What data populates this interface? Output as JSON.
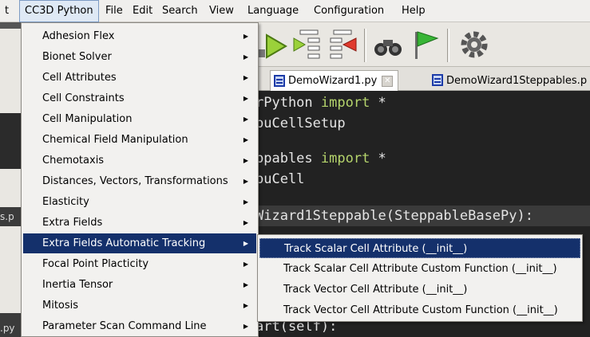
{
  "menubar": {
    "items": [
      {
        "label": "t"
      },
      {
        "label": "CC3D Python"
      },
      {
        "label": "File"
      },
      {
        "label": "Edit"
      },
      {
        "label": "Search"
      },
      {
        "label": "View"
      },
      {
        "label": "Language"
      },
      {
        "label": "Configuration"
      },
      {
        "label": "Help"
      }
    ]
  },
  "cc3d_menu": {
    "items": [
      {
        "label": "Adhesion Flex"
      },
      {
        "label": "Bionet Solver"
      },
      {
        "label": "Cell Attributes"
      },
      {
        "label": "Cell Constraints"
      },
      {
        "label": "Cell Manipulation"
      },
      {
        "label": "Chemical Field Manipulation"
      },
      {
        "label": "Chemotaxis"
      },
      {
        "label": "Distances, Vectors, Transformations"
      },
      {
        "label": "Elasticity"
      },
      {
        "label": "Extra Fields"
      },
      {
        "label": "Extra Fields Automatic Tracking"
      },
      {
        "label": "Focal Point Placticity"
      },
      {
        "label": "Inertia Tensor"
      },
      {
        "label": "Mitosis"
      },
      {
        "label": "Parameter Scan Command Line"
      }
    ],
    "arrow": "▶"
  },
  "tracking_submenu": {
    "items": [
      {
        "label": "Track Scalar Cell Attribute (__init__)"
      },
      {
        "label": "Track Scalar Cell Attribute Custom Function (__init__)"
      },
      {
        "label": "Track Vector Cell Attribute (__init__)"
      },
      {
        "label": "Track Vector Cell Attribute Custom Function (__init__)"
      }
    ]
  },
  "tabs": [
    {
      "label": "DemoWizard1.py",
      "close": "✕"
    },
    {
      "label": "DemoWizard1Steppables.p"
    }
  ],
  "editor": {
    "lines": [
      {
        "pre": "rPython ",
        "kw": "import",
        "post": " *"
      },
      {
        "pre": "puCellSetup",
        "kw": "",
        "post": ""
      },
      {
        "pre": "",
        "kw": "",
        "post": ""
      },
      {
        "pre": "ppables ",
        "kw": "import",
        "post": " *"
      },
      {
        "pre": "puCell",
        "kw": "",
        "post": ""
      },
      {
        "pre": "",
        "kw": "",
        "post": ""
      },
      {
        "pre": "Wizard1Steppable(SteppableBasePy):",
        "kw": "",
        "post": ""
      },
      {
        "pre": "",
        "kw": "",
        "post": ""
      },
      {
        "pre": "",
        "kw": "",
        "post": ""
      },
      {
        "pre": "",
        "kw": "",
        "post": ""
      },
      {
        "pre": "",
        "kw": "",
        "post": ""
      },
      {
        "pre": "",
        "kw": "",
        "post": ""
      },
      {
        "pre": "art(self):",
        "kw": "",
        "post": ""
      }
    ]
  },
  "side_text": {
    "left_top": "s.p",
    "left_bottom": ".py"
  },
  "icons": [
    "run-icon",
    "step-icon",
    "stop-icon",
    "binoculars-icon",
    "flag-icon",
    "gear-icon"
  ],
  "colors": {
    "menu_highlight": "#14306b",
    "editor_bg": "#222222",
    "keyword": "#b5d46c"
  }
}
